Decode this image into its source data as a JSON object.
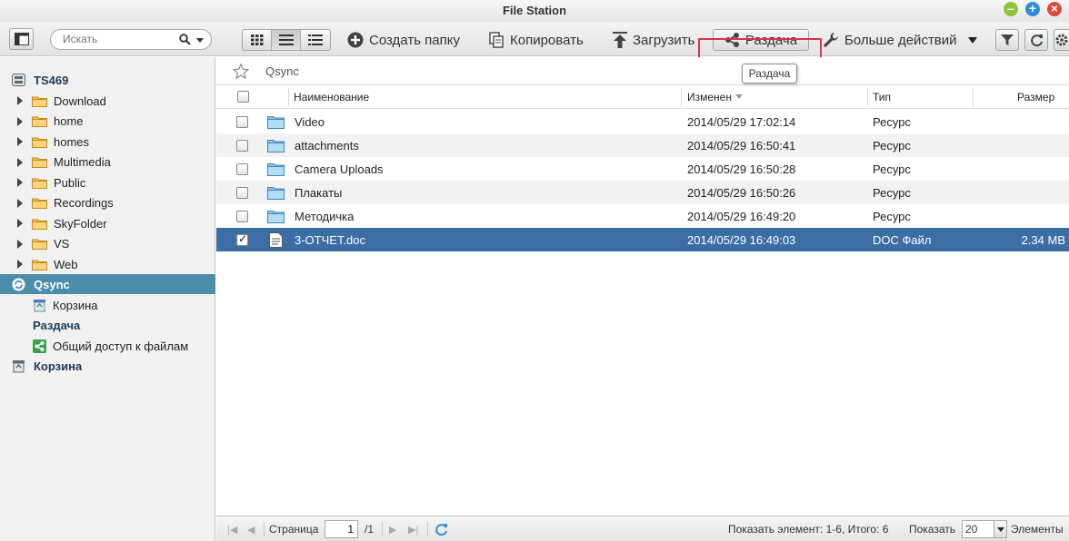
{
  "window": {
    "title": "File Station"
  },
  "search": {
    "placeholder": "Искать"
  },
  "toolbar": {
    "create_folder": "Создать папку",
    "copy": "Копировать",
    "upload": "Загрузить",
    "share": "Раздача",
    "more_actions": "Больше действий"
  },
  "tooltip": {
    "text": "Раздача"
  },
  "sidebar": {
    "root": "TS469",
    "folders": [
      "Download",
      "home",
      "homes",
      "Multimedia",
      "Public",
      "Recordings",
      "SkyFolder",
      "VS",
      "Web"
    ],
    "qsync": "Qsync",
    "qsync_children": {
      "trash": "Корзина",
      "share": "Раздача",
      "shared_files": "Общий доступ к файлам"
    },
    "recycle": "Корзина"
  },
  "path": {
    "crumb": "Qsync"
  },
  "table": {
    "headers": {
      "name": "Наименование",
      "modified": "Изменен",
      "type": "Тип",
      "size": "Размер"
    },
    "rows": [
      {
        "name": "Video",
        "modified": "2014/05/29 17:02:14",
        "type": "Ресурс",
        "size": "",
        "icon": "folder-icon",
        "checked": false
      },
      {
        "name": "attachments",
        "modified": "2014/05/29 16:50:41",
        "type": "Ресурс",
        "size": "",
        "icon": "folder-icon",
        "checked": false
      },
      {
        "name": "Camera Uploads",
        "modified": "2014/05/29 16:50:28",
        "type": "Ресурс",
        "size": "",
        "icon": "folder-icon",
        "checked": false
      },
      {
        "name": "Плакаты",
        "modified": "2014/05/29 16:50:26",
        "type": "Ресурс",
        "size": "",
        "icon": "folder-icon",
        "checked": false
      },
      {
        "name": "Методичка",
        "modified": "2014/05/29 16:49:20",
        "type": "Ресурс",
        "size": "",
        "icon": "folder-icon",
        "checked": false
      },
      {
        "name": "3-ОТЧЕТ.doc",
        "modified": "2014/05/29 16:49:03",
        "type": "DOC Файл",
        "size": "2.34 MB",
        "icon": "document-icon",
        "checked": true
      }
    ]
  },
  "pager": {
    "page_label": "Страница",
    "page_value": "1",
    "page_total": "/1",
    "summary": "Показать элемент: 1-6, Итого: 6",
    "show_label": "Показать",
    "page_size": "20",
    "items_label": "Элементы"
  },
  "colors": {
    "accent": "#4b8daa",
    "selection": "#3c6ea5",
    "highlight": "#d9363e"
  }
}
